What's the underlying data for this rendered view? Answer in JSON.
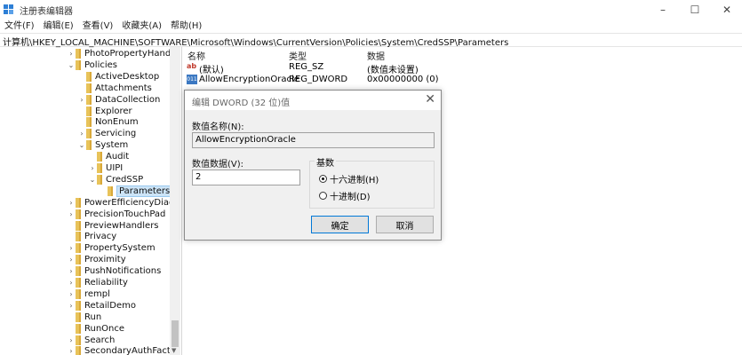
{
  "window": {
    "title": "注册表编辑器",
    "minimize": "–",
    "maximize": "☐",
    "close": "✕"
  },
  "menu": [
    "文件(F)",
    "编辑(E)",
    "查看(V)",
    "收藏夹(A)",
    "帮助(H)"
  ],
  "address": "计算机\\HKEY_LOCAL_MACHINE\\SOFTWARE\\Microsoft\\Windows\\CurrentVersion\\Policies\\System\\CredSSP\\Parameters",
  "tree": [
    {
      "label": "PhotoPropertyHandle",
      "arrow": "›"
    },
    {
      "label": "Policies",
      "arrow": "⌄"
    },
    {
      "label": "ActiveDesktop",
      "arrow": ""
    },
    {
      "label": "Attachments",
      "arrow": ""
    },
    {
      "label": "DataCollection",
      "arrow": "›"
    },
    {
      "label": "Explorer",
      "arrow": ""
    },
    {
      "label": "NonEnum",
      "arrow": ""
    },
    {
      "label": "Servicing",
      "arrow": "›"
    },
    {
      "label": "System",
      "arrow": "⌄"
    },
    {
      "label": "Audit",
      "arrow": ""
    },
    {
      "label": "UIPI",
      "arrow": "›"
    },
    {
      "label": "CredSSP",
      "arrow": "⌄"
    },
    {
      "label": "Parameters",
      "arrow": ""
    },
    {
      "label": "PowerEfficiencyDiagn",
      "arrow": "›"
    },
    {
      "label": "PrecisionTouchPad",
      "arrow": "›"
    },
    {
      "label": "PreviewHandlers",
      "arrow": ""
    },
    {
      "label": "Privacy",
      "arrow": ""
    },
    {
      "label": "PropertySystem",
      "arrow": "›"
    },
    {
      "label": "Proximity",
      "arrow": "›"
    },
    {
      "label": "PushNotifications",
      "arrow": "›"
    },
    {
      "label": "Reliability",
      "arrow": "›"
    },
    {
      "label": "rempl",
      "arrow": "›"
    },
    {
      "label": "RetailDemo",
      "arrow": "›"
    },
    {
      "label": "Run",
      "arrow": ""
    },
    {
      "label": "RunOnce",
      "arrow": ""
    },
    {
      "label": "Search",
      "arrow": "›"
    },
    {
      "label": "SecondaryAuthFacto",
      "arrow": "›"
    }
  ],
  "list": {
    "headers": {
      "name": "名称",
      "type": "类型",
      "data": "数据"
    },
    "rows": [
      {
        "icon": "string-value-icon",
        "name": "(默认)",
        "type": "REG_SZ",
        "data": "(数值未设置)"
      },
      {
        "icon": "dword-value-icon",
        "name": "AllowEncryptionOracle",
        "type": "REG_DWORD",
        "data": "0x00000000 (0)"
      }
    ]
  },
  "dialog": {
    "title": "编辑 DWORD (32 位)值",
    "close": "✕",
    "name_label": "数值名称(N):",
    "name_value": "AllowEncryptionOracle",
    "data_label": "数值数据(V):",
    "data_value": "2",
    "base_label": "基数",
    "hex_label": "十六进制(H)",
    "dec_label": "十进制(D)",
    "hex_checked": true,
    "ok_label": "确定",
    "cancel_label": "取消"
  }
}
